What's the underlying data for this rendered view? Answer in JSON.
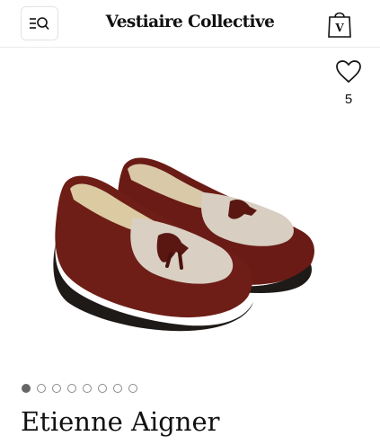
{
  "header": {
    "brand": "Vestiaire Collective",
    "bag_letter": "V"
  },
  "favorites": {
    "count": "5"
  },
  "carousel": {
    "total_slides": 8,
    "active_index": 0
  },
  "product": {
    "title": "Etienne Aigner"
  },
  "icons": {
    "menu": "menu-search-icon",
    "bag": "shopping-bag-icon",
    "favorite": "heart-icon"
  },
  "colors": {
    "leather": "#6b1c16",
    "canvas": "#d9cfc1",
    "sole": "#1e1a18",
    "dot_active": "#666666"
  }
}
